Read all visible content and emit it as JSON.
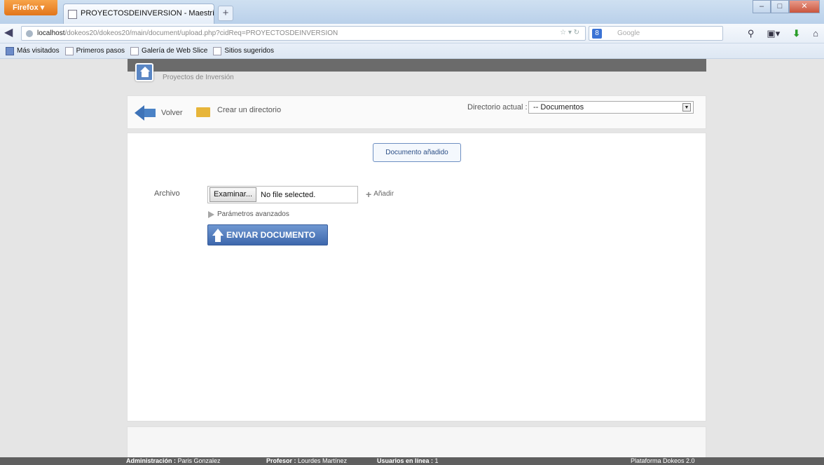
{
  "browser": {
    "menu_label": "Firefox",
    "tab_title": "PROYECTOSDEINVERSION - Maestría en ...",
    "new_tab_label": "+",
    "url_host": "localhost",
    "url_path": "/dokeos20/dokeos20/main/document/upload.php?cidReq=PROYECTOSDEINVERSION",
    "search_placeholder": "Google",
    "search_engine_letter": "8",
    "bookmarks": [
      "Más visitados",
      "Primeros pasos",
      "Galería de Web Slice",
      "Sitios sugeridos"
    ]
  },
  "course": {
    "name": "Proyectos de Inversión"
  },
  "toolbar": {
    "back_label": "Volver",
    "create_dir_label": "Crear un directorio",
    "current_dir_label": "Directorio actual :",
    "current_dir_value": "-- Documentos"
  },
  "upload": {
    "notice": "Documento añadido",
    "file_label": "Archivo",
    "browse_button": "Examinar...",
    "file_status": "No file selected.",
    "add_label": "Añadir",
    "advanced_label": "Parámetros avanzados",
    "submit_label": "ENVIAR DOCUMENTO"
  },
  "footer": {
    "admin_label": "Administración :",
    "admin_name": "Paris Gonzalez",
    "teacher_label": "Profesor :",
    "teacher_name": "Lourdes Martínez",
    "users_label": "Usuarios en línea :",
    "users_count": "1",
    "platform": "Plataforma Dokeos 2.0"
  }
}
